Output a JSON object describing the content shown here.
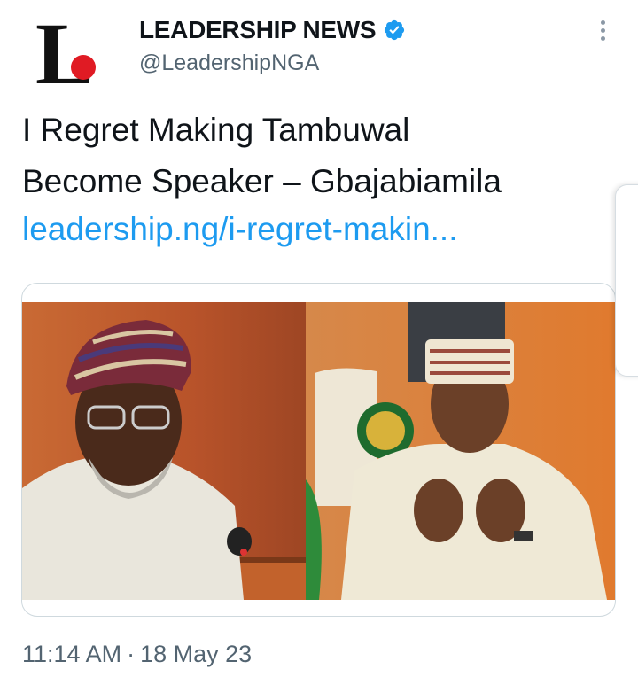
{
  "account": {
    "display_name": "LEADERSHIP NEWS",
    "handle": "@LeadershipNGA",
    "verified": true,
    "logo_letter": "L"
  },
  "tweet": {
    "text_line1": "I Regret Making Tambuwal",
    "text_line2": "Become Speaker – Gbajabiamila",
    "link": "leadership.ng/i-regret-makin..."
  },
  "footer": {
    "time": "11:14 AM",
    "separator": "·",
    "date": "18 May 23"
  },
  "icons": {
    "verified": "verified-badge-icon",
    "more": "more-options-icon"
  },
  "colors": {
    "link": "#1d9bf0",
    "verified_badge": "#1d9bf0",
    "secondary_text": "#536471",
    "logo_dot": "#e01b24"
  }
}
